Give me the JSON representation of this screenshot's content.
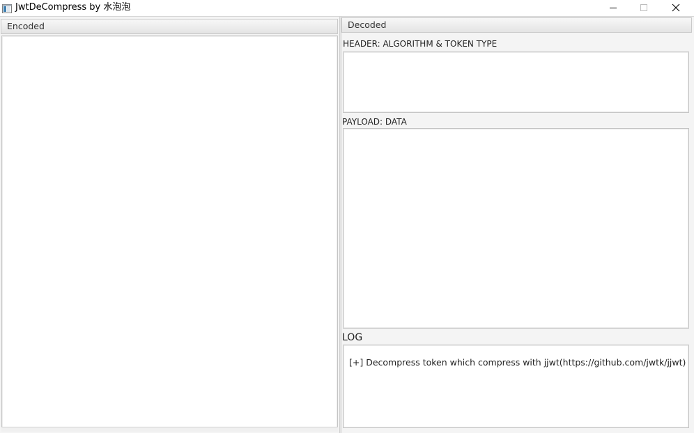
{
  "window": {
    "title": "JwtDeCompress by 水泡泡"
  },
  "icons": {
    "app": "app-window-icon",
    "minimize": "minimize-icon",
    "maximize": "maximize-icon",
    "close": "close-icon"
  },
  "encoded": {
    "title": "Encoded",
    "value": ""
  },
  "decoded": {
    "title": "Decoded",
    "header_label": "HEADER:  ALGORITHM & TOKEN TYPE",
    "header_value": "",
    "payload_label": "PAYLOAD: DATA",
    "payload_value": "",
    "log_label": "LOG",
    "log_lines": [
      "[+] Decompress token which compress with jjwt(https://github.com/jwtk/jjwt)"
    ]
  },
  "colors": {
    "pane_background": "#f4f4f4",
    "textarea_background": "#ffffff",
    "border": "#c4c4c4"
  }
}
